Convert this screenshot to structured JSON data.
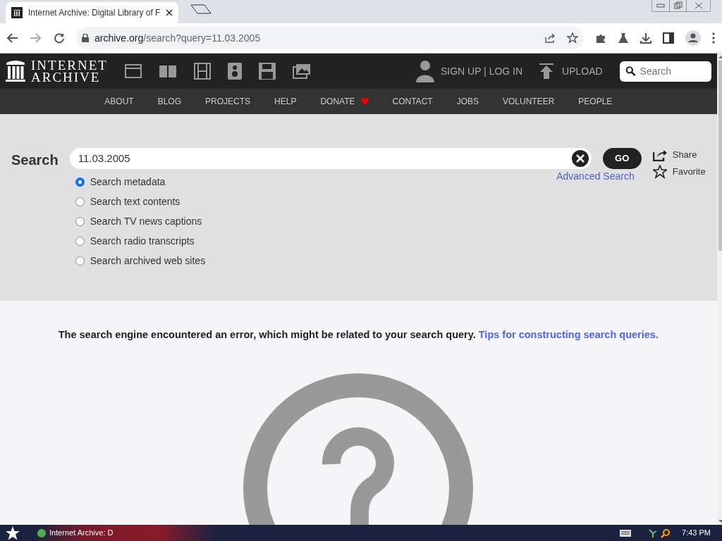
{
  "browser": {
    "tab_title": "Internet Archive: Digital Library of F",
    "url_host": "archive.org",
    "url_path": "/search?query=11.03.2005"
  },
  "header": {
    "logo_lines": [
      "INTERNET",
      "ARCHIVE"
    ],
    "account": "SIGN UP | LOG IN",
    "upload": "UPLOAD",
    "search_placeholder": "Search"
  },
  "nav": [
    {
      "label": "ABOUT",
      "heart": false
    },
    {
      "label": "BLOG",
      "heart": false
    },
    {
      "label": "PROJECTS",
      "heart": false
    },
    {
      "label": "HELP",
      "heart": false
    },
    {
      "label": "DONATE",
      "heart": true
    },
    {
      "label": "CONTACT",
      "heart": false
    },
    {
      "label": "JOBS",
      "heart": false
    },
    {
      "label": "VOLUNTEER",
      "heart": false
    },
    {
      "label": "PEOPLE",
      "heart": false
    }
  ],
  "search": {
    "label": "Search",
    "value": "11.03.2005",
    "go": "GO",
    "advanced": "Advanced Search",
    "share": "Share",
    "favorite": "Favorite",
    "options": [
      {
        "label": "Search metadata",
        "selected": true
      },
      {
        "label": "Search text contents",
        "selected": false
      },
      {
        "label": "Search TV news captions",
        "selected": false
      },
      {
        "label": "Search radio transcripts",
        "selected": false
      },
      {
        "label": "Search archived web sites",
        "selected": false
      }
    ]
  },
  "error": {
    "message": "The search engine encountered an error, which might be related to your search query.",
    "link": "Tips for constructing search queries."
  },
  "taskbar": {
    "window": "Internet Archive: D",
    "clock": "7:43 PM"
  }
}
